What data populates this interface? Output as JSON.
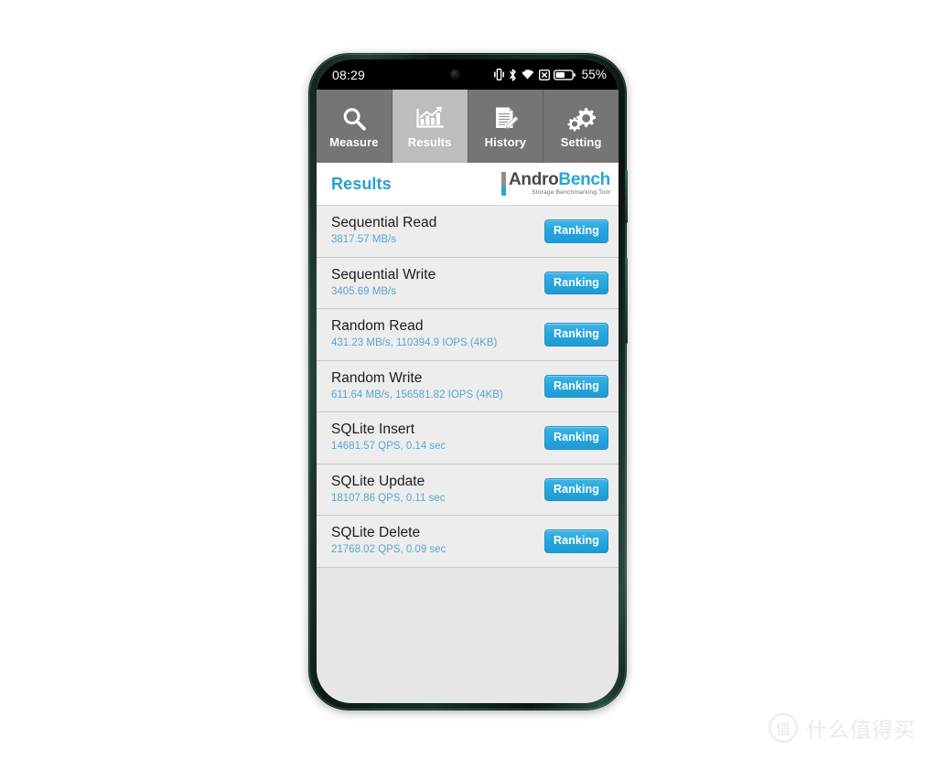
{
  "device": {
    "frame_color": "#16302a",
    "side_buttons": [
      "power-button",
      "volume-button"
    ]
  },
  "statusbar": {
    "time": "08:29",
    "battery_percent": "55%",
    "icons": [
      "vibrate-icon",
      "bluetooth-icon",
      "wifi-icon",
      "no-sim-icon",
      "battery-icon"
    ],
    "camera": "front-camera-punch-hole"
  },
  "tabs": [
    {
      "label": "Measure",
      "icon": "magnifier-icon",
      "selected": false
    },
    {
      "label": "Results",
      "icon": "bar-chart-icon",
      "selected": true
    },
    {
      "label": "History",
      "icon": "document-pen-icon",
      "selected": false
    },
    {
      "label": "Setting",
      "icon": "gears-icon",
      "selected": false
    }
  ],
  "header": {
    "title": "Results",
    "logo_andro": "Andro",
    "logo_bench": "Bench",
    "logo_tagline": "Storage Benchmarking Tool"
  },
  "rows": [
    {
      "title": "Sequential Read",
      "value": "3817.57 MB/s",
      "button": "Ranking"
    },
    {
      "title": "Sequential Write",
      "value": "3405.69 MB/s",
      "button": "Ranking"
    },
    {
      "title": "Random Read",
      "value": "431.23 MB/s, 110394.9 IOPS (4KB)",
      "button": "Ranking"
    },
    {
      "title": "Random Write",
      "value": "611.64 MB/s, 156581.82 IOPS (4KB)",
      "button": "Ranking"
    },
    {
      "title": "SQLite Insert",
      "value": "14681.57 QPS, 0.14 sec",
      "button": "Ranking"
    },
    {
      "title": "SQLite Update",
      "value": "18107.86 QPS, 0.11 sec",
      "button": "Ranking"
    },
    {
      "title": "SQLite Delete",
      "value": "21768.02 QPS, 0.09 sec",
      "button": "Ranking"
    }
  ],
  "watermark": {
    "badge": "值",
    "text": "什么值得买"
  },
  "colors": {
    "accent_blue": "#29a3da",
    "title_blue": "#2c9fd0",
    "value_blue": "#5aa7cf",
    "tab_unselected": "#757575",
    "tab_selected": "#bdbdbd",
    "row_bg": "#ededed",
    "screen_bg": "#e6e6e6"
  }
}
